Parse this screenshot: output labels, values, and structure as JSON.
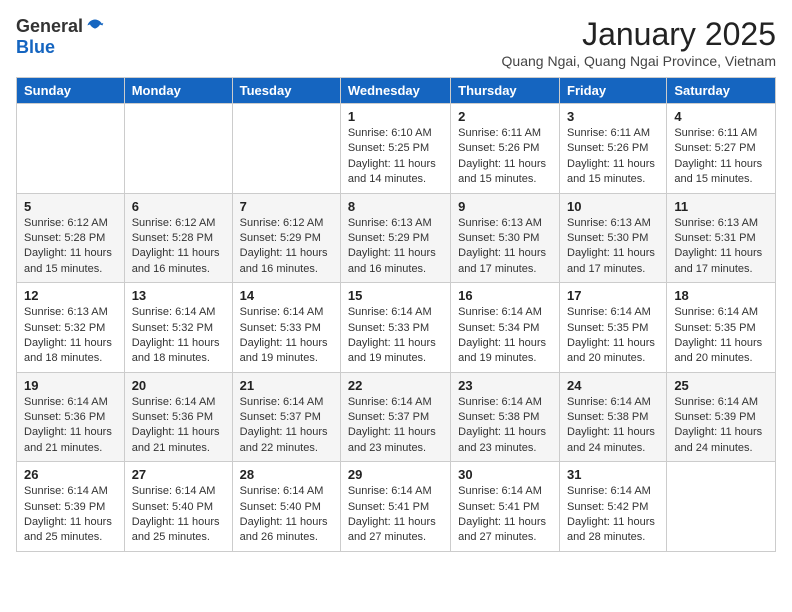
{
  "logo": {
    "general": "General",
    "blue": "Blue"
  },
  "header": {
    "month_year": "January 2025",
    "location": "Quang Ngai, Quang Ngai Province, Vietnam"
  },
  "weekdays": [
    "Sunday",
    "Monday",
    "Tuesday",
    "Wednesday",
    "Thursday",
    "Friday",
    "Saturday"
  ],
  "weeks": [
    [
      {
        "day": "",
        "info": ""
      },
      {
        "day": "",
        "info": ""
      },
      {
        "day": "",
        "info": ""
      },
      {
        "day": "1",
        "info": "Sunrise: 6:10 AM\nSunset: 5:25 PM\nDaylight: 11 hours and 14 minutes."
      },
      {
        "day": "2",
        "info": "Sunrise: 6:11 AM\nSunset: 5:26 PM\nDaylight: 11 hours and 15 minutes."
      },
      {
        "day": "3",
        "info": "Sunrise: 6:11 AM\nSunset: 5:26 PM\nDaylight: 11 hours and 15 minutes."
      },
      {
        "day": "4",
        "info": "Sunrise: 6:11 AM\nSunset: 5:27 PM\nDaylight: 11 hours and 15 minutes."
      }
    ],
    [
      {
        "day": "5",
        "info": "Sunrise: 6:12 AM\nSunset: 5:28 PM\nDaylight: 11 hours and 15 minutes."
      },
      {
        "day": "6",
        "info": "Sunrise: 6:12 AM\nSunset: 5:28 PM\nDaylight: 11 hours and 16 minutes."
      },
      {
        "day": "7",
        "info": "Sunrise: 6:12 AM\nSunset: 5:29 PM\nDaylight: 11 hours and 16 minutes."
      },
      {
        "day": "8",
        "info": "Sunrise: 6:13 AM\nSunset: 5:29 PM\nDaylight: 11 hours and 16 minutes."
      },
      {
        "day": "9",
        "info": "Sunrise: 6:13 AM\nSunset: 5:30 PM\nDaylight: 11 hours and 17 minutes."
      },
      {
        "day": "10",
        "info": "Sunrise: 6:13 AM\nSunset: 5:30 PM\nDaylight: 11 hours and 17 minutes."
      },
      {
        "day": "11",
        "info": "Sunrise: 6:13 AM\nSunset: 5:31 PM\nDaylight: 11 hours and 17 minutes."
      }
    ],
    [
      {
        "day": "12",
        "info": "Sunrise: 6:13 AM\nSunset: 5:32 PM\nDaylight: 11 hours and 18 minutes."
      },
      {
        "day": "13",
        "info": "Sunrise: 6:14 AM\nSunset: 5:32 PM\nDaylight: 11 hours and 18 minutes."
      },
      {
        "day": "14",
        "info": "Sunrise: 6:14 AM\nSunset: 5:33 PM\nDaylight: 11 hours and 19 minutes."
      },
      {
        "day": "15",
        "info": "Sunrise: 6:14 AM\nSunset: 5:33 PM\nDaylight: 11 hours and 19 minutes."
      },
      {
        "day": "16",
        "info": "Sunrise: 6:14 AM\nSunset: 5:34 PM\nDaylight: 11 hours and 19 minutes."
      },
      {
        "day": "17",
        "info": "Sunrise: 6:14 AM\nSunset: 5:35 PM\nDaylight: 11 hours and 20 minutes."
      },
      {
        "day": "18",
        "info": "Sunrise: 6:14 AM\nSunset: 5:35 PM\nDaylight: 11 hours and 20 minutes."
      }
    ],
    [
      {
        "day": "19",
        "info": "Sunrise: 6:14 AM\nSunset: 5:36 PM\nDaylight: 11 hours and 21 minutes."
      },
      {
        "day": "20",
        "info": "Sunrise: 6:14 AM\nSunset: 5:36 PM\nDaylight: 11 hours and 21 minutes."
      },
      {
        "day": "21",
        "info": "Sunrise: 6:14 AM\nSunset: 5:37 PM\nDaylight: 11 hours and 22 minutes."
      },
      {
        "day": "22",
        "info": "Sunrise: 6:14 AM\nSunset: 5:37 PM\nDaylight: 11 hours and 23 minutes."
      },
      {
        "day": "23",
        "info": "Sunrise: 6:14 AM\nSunset: 5:38 PM\nDaylight: 11 hours and 23 minutes."
      },
      {
        "day": "24",
        "info": "Sunrise: 6:14 AM\nSunset: 5:38 PM\nDaylight: 11 hours and 24 minutes."
      },
      {
        "day": "25",
        "info": "Sunrise: 6:14 AM\nSunset: 5:39 PM\nDaylight: 11 hours and 24 minutes."
      }
    ],
    [
      {
        "day": "26",
        "info": "Sunrise: 6:14 AM\nSunset: 5:39 PM\nDaylight: 11 hours and 25 minutes."
      },
      {
        "day": "27",
        "info": "Sunrise: 6:14 AM\nSunset: 5:40 PM\nDaylight: 11 hours and 25 minutes."
      },
      {
        "day": "28",
        "info": "Sunrise: 6:14 AM\nSunset: 5:40 PM\nDaylight: 11 hours and 26 minutes."
      },
      {
        "day": "29",
        "info": "Sunrise: 6:14 AM\nSunset: 5:41 PM\nDaylight: 11 hours and 27 minutes."
      },
      {
        "day": "30",
        "info": "Sunrise: 6:14 AM\nSunset: 5:41 PM\nDaylight: 11 hours and 27 minutes."
      },
      {
        "day": "31",
        "info": "Sunrise: 6:14 AM\nSunset: 5:42 PM\nDaylight: 11 hours and 28 minutes."
      },
      {
        "day": "",
        "info": ""
      }
    ]
  ]
}
